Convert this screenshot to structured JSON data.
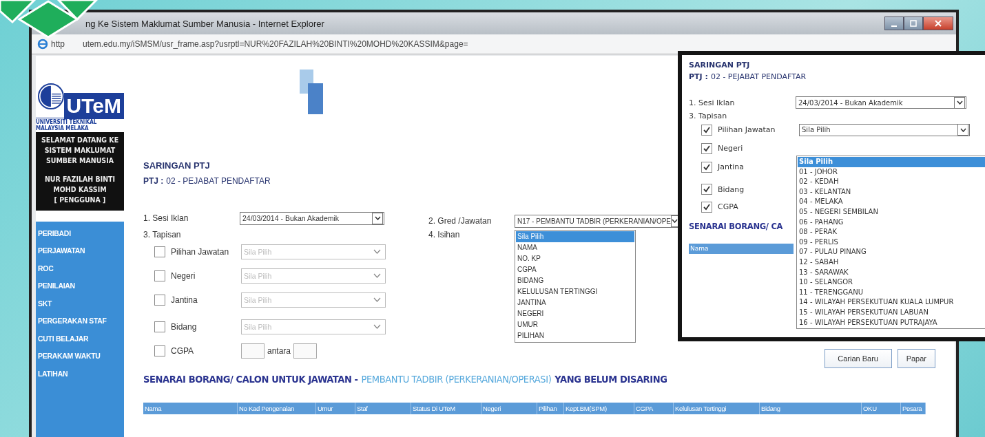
{
  "window": {
    "title": "ng Ke Sistem Maklumat Sumber Manusia - Internet Explorer",
    "address_start": "http",
    "address_rest": "utem.edu.my/iSMSM/usr_frame.asp?usrptl=NUR%20FAZILAH%20BINTI%20MOHD%20KASSIM&page="
  },
  "sidebar": {
    "logo_text": "UTeM",
    "logo_caption": "UNIVERSITI TEKNIKAL MALAYSIA MELAKA",
    "welcome": "SELAMAT DATANG KE SISTEM MAKLUMAT SUMBER MANUSIA",
    "user": "NUR FAZILAH BINTI MOHD KASSIM",
    "role": "[ PENGGUNA ]",
    "items": [
      "PERIBADI",
      "PERJAWATAN",
      "ROC",
      "PENILAIAN",
      "SKT",
      "PERGERAKAN STAF",
      "CUTI BELAJAR",
      "PERAKAM WAKTU",
      "LATIHAN"
    ]
  },
  "form": {
    "title": "SARINGAN PTJ",
    "ptj_label": "PTJ :",
    "ptj_value": "02 - PEJABAT PENDAFTAR",
    "sesi": {
      "label": "1. Sesi Iklan",
      "value": "24/03/2014 - Bukan Akademik"
    },
    "tapisan": "3. Tapisan",
    "filters": [
      {
        "kind": "select",
        "label": "Pilihan Jawatan",
        "checked": false,
        "placeholder": "Sila Pilih"
      },
      {
        "kind": "select",
        "label": "Negeri",
        "checked": false,
        "placeholder": "Sila Pilih"
      },
      {
        "kind": "select",
        "label": "Jantina",
        "checked": false,
        "placeholder": "Sila Pilih"
      },
      {
        "kind": "select",
        "label": "Bidang",
        "checked": false,
        "placeholder": "Sila Pilih"
      },
      {
        "kind": "range",
        "label": "CGPA",
        "checked": false,
        "between": "antara"
      }
    ],
    "gred": {
      "label": "2.  Gred /Jawatan",
      "value": "N17 - PEMBANTU TADBIR (PERKERANIAN/OPE"
    },
    "isihan": {
      "label": "4.  Isihan",
      "options": [
        {
          "text": "Sila Pilih",
          "selected": true
        },
        {
          "text": "NAMA",
          "selected": false
        },
        {
          "text": "NO. KP",
          "selected": false
        },
        {
          "text": "CGPA",
          "selected": false
        },
        {
          "text": "BIDANG",
          "selected": false
        },
        {
          "text": "KELULUSAN TERTINGGI",
          "selected": false
        },
        {
          "text": "JANTINA",
          "selected": false
        },
        {
          "text": "NEGERI",
          "selected": false
        },
        {
          "text": "UMUR",
          "selected": false
        },
        {
          "text": "PILIHAN",
          "selected": false
        }
      ]
    },
    "buttons": [
      "Carian Baru",
      "Papar"
    ]
  },
  "list": {
    "heading_start": "SENARAI BORANG/ CALON UNTUK JAWATAN -",
    "heading_job": "PEMBANTU TADBIR (PERKERANIAN/OPERASI)",
    "heading_end": "YANG BELUM DISARING",
    "columns": [
      "Nama",
      "No Kad Pengenalan",
      "Umur",
      "Staf",
      "Status Di UTeM",
      "Negeri",
      "Pilihan",
      "Kept.BM(SPM)",
      "CGPA",
      "Kelulusan Tertinggi",
      "Bidang",
      "OKU",
      "Pesara"
    ]
  },
  "inset": {
    "title": "SARINGAN PTJ",
    "ptj_label": "PTJ :",
    "ptj_value": "02 - PEJABAT PENDAFTAR",
    "sesi_label": "1. Sesi Iklan",
    "sesi_value": "24/03/2014 - Bukan Akademik",
    "tapisan": "3. Tapisan",
    "filters": [
      {
        "label": "Pilihan Jawatan",
        "checked": true
      },
      {
        "label": "Negeri",
        "checked": true
      },
      {
        "label": "Jantina",
        "checked": true
      },
      {
        "label": "Bidang",
        "checked": true
      },
      {
        "label": "CGPA",
        "checked": true
      }
    ],
    "select_value": "Sila Pilih",
    "options": [
      {
        "text": "Sila Pilih",
        "selected": true
      },
      {
        "text": "01 - JOHOR",
        "selected": false
      },
      {
        "text": "02 - KEDAH",
        "selected": false
      },
      {
        "text": "03 - KELANTAN",
        "selected": false
      },
      {
        "text": "04 - MELAKA",
        "selected": false
      },
      {
        "text": "05 - NEGERI SEMBILAN",
        "selected": false
      },
      {
        "text": "06 - PAHANG",
        "selected": false
      },
      {
        "text": "08 - PERAK",
        "selected": false
      },
      {
        "text": "09 - PERLIS",
        "selected": false
      },
      {
        "text": "07 - PULAU PINANG",
        "selected": false
      },
      {
        "text": "12 - SABAH",
        "selected": false
      },
      {
        "text": "13 - SARAWAK",
        "selected": false
      },
      {
        "text": "10 - SELANGOR",
        "selected": false
      },
      {
        "text": "11 - TERENGGANU",
        "selected": false
      },
      {
        "text": "14 - WILAYAH PERSEKUTUAN KUALA LUMPUR",
        "selected": false
      },
      {
        "text": "15 - WILAYAH PERSEKUTUAN LABUAN",
        "selected": false
      },
      {
        "text": "16 - WILAYAH PERSEKUTUAN PUTRAJAYA",
        "selected": false
      }
    ],
    "heading": "SENARAI BORANG/ CA",
    "column": "Nama"
  }
}
